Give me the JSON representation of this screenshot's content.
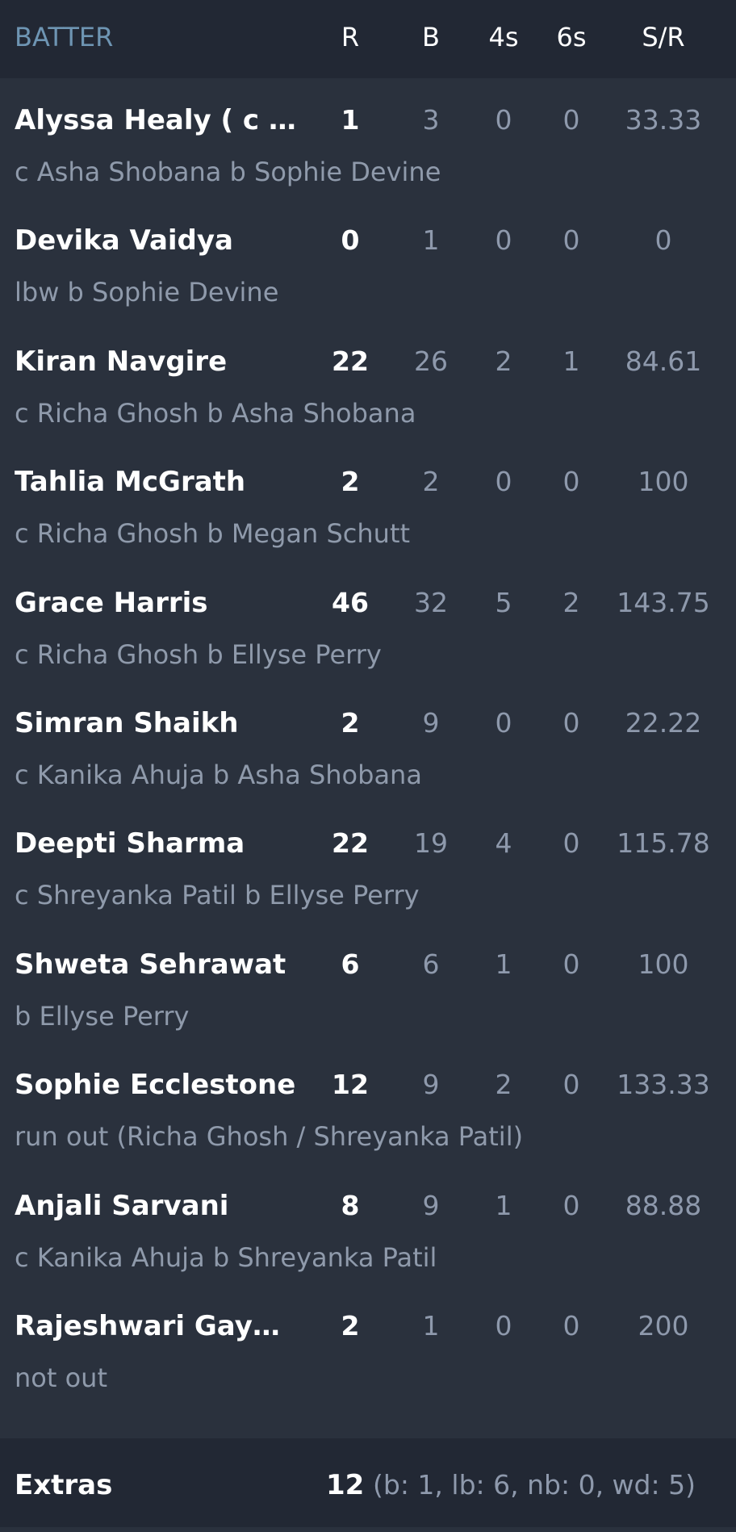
{
  "header": {
    "batter": "BATTER",
    "runs": "R",
    "balls": "B",
    "fours": "4s",
    "sixes": "6s",
    "strike_rate": "S/R"
  },
  "batters": [
    {
      "name": "Alyssa Healy ( c ) &…",
      "r": "1",
      "b": "3",
      "fours": "0",
      "sixes": "0",
      "sr": "33.33",
      "dismissal": "c Asha Shobana b Sophie Devine"
    },
    {
      "name": "Devika Vaidya",
      "r": "0",
      "b": "1",
      "fours": "0",
      "sixes": "0",
      "sr": "0",
      "dismissal": "lbw b Sophie Devine"
    },
    {
      "name": "Kiran Navgire",
      "r": "22",
      "b": "26",
      "fours": "2",
      "sixes": "1",
      "sr": "84.61",
      "dismissal": "c Richa Ghosh b Asha Shobana"
    },
    {
      "name": "Tahlia McGrath",
      "r": "2",
      "b": "2",
      "fours": "0",
      "sixes": "0",
      "sr": "100",
      "dismissal": "c Richa Ghosh b Megan Schutt"
    },
    {
      "name": "Grace Harris",
      "r": "46",
      "b": "32",
      "fours": "5",
      "sixes": "2",
      "sr": "143.75",
      "dismissal": "c Richa Ghosh b Ellyse Perry"
    },
    {
      "name": "Simran Shaikh",
      "r": "2",
      "b": "9",
      "fours": "0",
      "sixes": "0",
      "sr": "22.22",
      "dismissal": "c Kanika Ahuja b Asha Shobana"
    },
    {
      "name": "Deepti Sharma",
      "r": "22",
      "b": "19",
      "fours": "4",
      "sixes": "0",
      "sr": "115.78",
      "dismissal": "c Shreyanka Patil b Ellyse Perry"
    },
    {
      "name": "Shweta Sehrawat",
      "r": "6",
      "b": "6",
      "fours": "1",
      "sixes": "0",
      "sr": "100",
      "dismissal": "b Ellyse Perry"
    },
    {
      "name": "Sophie Ecclestone",
      "r": "12",
      "b": "9",
      "fours": "2",
      "sixes": "0",
      "sr": "133.33",
      "dismissal": "run out (Richa Ghosh / Shreyanka Patil)"
    },
    {
      "name": "Anjali Sarvani",
      "r": "8",
      "b": "9",
      "fours": "1",
      "sixes": "0",
      "sr": "88.88",
      "dismissal": "c Kanika Ahuja b Shreyanka Patil"
    },
    {
      "name": "Rajeshwari Gayakw…",
      "r": "2",
      "b": "1",
      "fours": "0",
      "sixes": "0",
      "sr": "200",
      "dismissal": "not out"
    }
  ],
  "extras": {
    "label": "Extras",
    "total": "12",
    "breakdown": "(b: 1, lb: 6, nb: 0, wd: 5)"
  },
  "colors": {
    "background": "#2a313d",
    "header_background": "#222834",
    "batter_header_accent": "#6e95b3",
    "muted_text": "#8e99ac"
  }
}
